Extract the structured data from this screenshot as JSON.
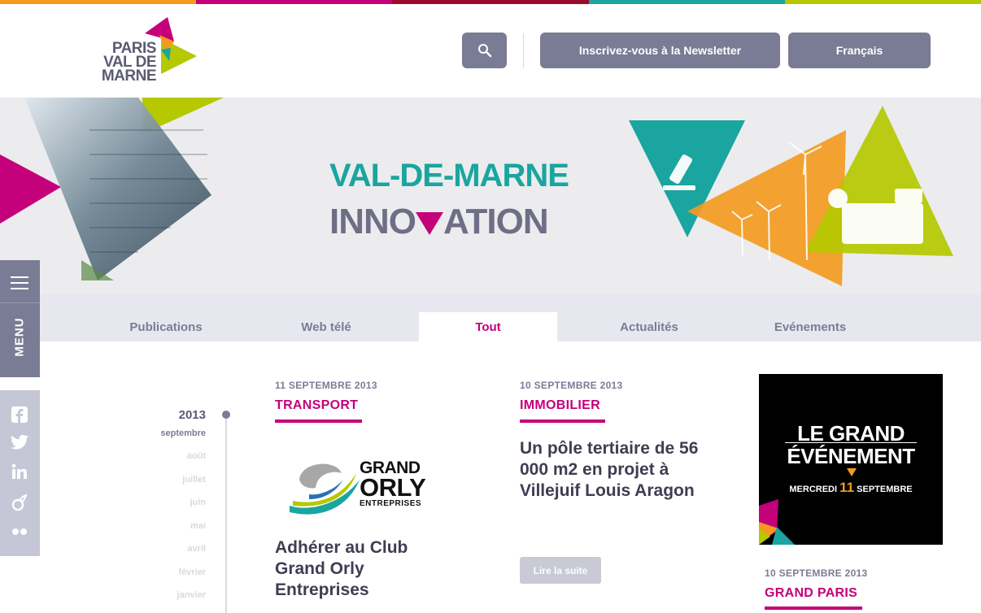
{
  "colors": {
    "topbar": [
      "#f39a1f",
      "#c4007b",
      "#9b0a2c",
      "#1aa5a0",
      "#b5c800"
    ],
    "accent": "#c4007b",
    "button": "#7a7c95"
  },
  "header": {
    "logo_line1": "PARIS",
    "logo_line2": "VAL DE MARNE",
    "search_icon": "search-icon",
    "newsletter_label": "Inscrivez-vous à la Newsletter",
    "language_label": "Français"
  },
  "banner": {
    "title_line1": "VAL-DE-MARNE",
    "title_line2_a": "INNO",
    "title_line2_b": "ATION"
  },
  "side": {
    "menu_label": "MENU",
    "social_icons": [
      "facebook-icon",
      "twitter-icon",
      "linkedin-icon",
      "viadeo-icon",
      "flickr-icon"
    ]
  },
  "tabs": [
    "Publications",
    "Web télé",
    "Tout",
    "Actualités",
    "Evénements"
  ],
  "timeline": {
    "year": "2013",
    "months": [
      "septembre",
      "août",
      "juillet",
      "juin",
      "mai",
      "avril",
      "février",
      "janvier"
    ]
  },
  "articles": [
    {
      "date": "11 SEPTEMBRE 2013",
      "category": "TRANSPORT",
      "title": "Adhérer au Club Grand Orly Entreprises",
      "logo_line1": "GRAND",
      "logo_line2": "ORLY",
      "logo_line3": "ENTREPRISES"
    },
    {
      "date": "10 SEPTEMBRE 2013",
      "category": "IMMOBILIER",
      "title": "Un pôle tertiaire de 56 000 m2 en projet à Villejuif Louis Aragon",
      "more": "Lire la suite"
    },
    {
      "date": "10 SEPTEMBRE 2013",
      "category": "GRAND PARIS"
    }
  ],
  "event": {
    "line1": "LE GRAND",
    "line2": "ÉVÉNEMENT",
    "date_a": "MERCREDI",
    "date_day": "11",
    "date_b": "SEPTEMBRE"
  }
}
